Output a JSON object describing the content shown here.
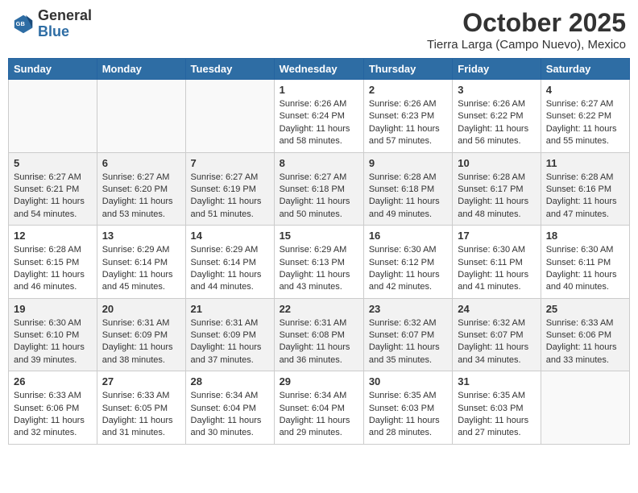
{
  "header": {
    "logo_general": "General",
    "logo_blue": "Blue",
    "month": "October 2025",
    "location": "Tierra Larga (Campo Nuevo), Mexico"
  },
  "weekdays": [
    "Sunday",
    "Monday",
    "Tuesday",
    "Wednesday",
    "Thursday",
    "Friday",
    "Saturday"
  ],
  "weeks": [
    [
      {
        "day": "",
        "sunrise": "",
        "sunset": "",
        "daylight": ""
      },
      {
        "day": "",
        "sunrise": "",
        "sunset": "",
        "daylight": ""
      },
      {
        "day": "",
        "sunrise": "",
        "sunset": "",
        "daylight": ""
      },
      {
        "day": "1",
        "sunrise": "Sunrise: 6:26 AM",
        "sunset": "Sunset: 6:24 PM",
        "daylight": "Daylight: 11 hours and 58 minutes."
      },
      {
        "day": "2",
        "sunrise": "Sunrise: 6:26 AM",
        "sunset": "Sunset: 6:23 PM",
        "daylight": "Daylight: 11 hours and 57 minutes."
      },
      {
        "day": "3",
        "sunrise": "Sunrise: 6:26 AM",
        "sunset": "Sunset: 6:22 PM",
        "daylight": "Daylight: 11 hours and 56 minutes."
      },
      {
        "day": "4",
        "sunrise": "Sunrise: 6:27 AM",
        "sunset": "Sunset: 6:22 PM",
        "daylight": "Daylight: 11 hours and 55 minutes."
      }
    ],
    [
      {
        "day": "5",
        "sunrise": "Sunrise: 6:27 AM",
        "sunset": "Sunset: 6:21 PM",
        "daylight": "Daylight: 11 hours and 54 minutes."
      },
      {
        "day": "6",
        "sunrise": "Sunrise: 6:27 AM",
        "sunset": "Sunset: 6:20 PM",
        "daylight": "Daylight: 11 hours and 53 minutes."
      },
      {
        "day": "7",
        "sunrise": "Sunrise: 6:27 AM",
        "sunset": "Sunset: 6:19 PM",
        "daylight": "Daylight: 11 hours and 51 minutes."
      },
      {
        "day": "8",
        "sunrise": "Sunrise: 6:27 AM",
        "sunset": "Sunset: 6:18 PM",
        "daylight": "Daylight: 11 hours and 50 minutes."
      },
      {
        "day": "9",
        "sunrise": "Sunrise: 6:28 AM",
        "sunset": "Sunset: 6:18 PM",
        "daylight": "Daylight: 11 hours and 49 minutes."
      },
      {
        "day": "10",
        "sunrise": "Sunrise: 6:28 AM",
        "sunset": "Sunset: 6:17 PM",
        "daylight": "Daylight: 11 hours and 48 minutes."
      },
      {
        "day": "11",
        "sunrise": "Sunrise: 6:28 AM",
        "sunset": "Sunset: 6:16 PM",
        "daylight": "Daylight: 11 hours and 47 minutes."
      }
    ],
    [
      {
        "day": "12",
        "sunrise": "Sunrise: 6:28 AM",
        "sunset": "Sunset: 6:15 PM",
        "daylight": "Daylight: 11 hours and 46 minutes."
      },
      {
        "day": "13",
        "sunrise": "Sunrise: 6:29 AM",
        "sunset": "Sunset: 6:14 PM",
        "daylight": "Daylight: 11 hours and 45 minutes."
      },
      {
        "day": "14",
        "sunrise": "Sunrise: 6:29 AM",
        "sunset": "Sunset: 6:14 PM",
        "daylight": "Daylight: 11 hours and 44 minutes."
      },
      {
        "day": "15",
        "sunrise": "Sunrise: 6:29 AM",
        "sunset": "Sunset: 6:13 PM",
        "daylight": "Daylight: 11 hours and 43 minutes."
      },
      {
        "day": "16",
        "sunrise": "Sunrise: 6:30 AM",
        "sunset": "Sunset: 6:12 PM",
        "daylight": "Daylight: 11 hours and 42 minutes."
      },
      {
        "day": "17",
        "sunrise": "Sunrise: 6:30 AM",
        "sunset": "Sunset: 6:11 PM",
        "daylight": "Daylight: 11 hours and 41 minutes."
      },
      {
        "day": "18",
        "sunrise": "Sunrise: 6:30 AM",
        "sunset": "Sunset: 6:11 PM",
        "daylight": "Daylight: 11 hours and 40 minutes."
      }
    ],
    [
      {
        "day": "19",
        "sunrise": "Sunrise: 6:30 AM",
        "sunset": "Sunset: 6:10 PM",
        "daylight": "Daylight: 11 hours and 39 minutes."
      },
      {
        "day": "20",
        "sunrise": "Sunrise: 6:31 AM",
        "sunset": "Sunset: 6:09 PM",
        "daylight": "Daylight: 11 hours and 38 minutes."
      },
      {
        "day": "21",
        "sunrise": "Sunrise: 6:31 AM",
        "sunset": "Sunset: 6:09 PM",
        "daylight": "Daylight: 11 hours and 37 minutes."
      },
      {
        "day": "22",
        "sunrise": "Sunrise: 6:31 AM",
        "sunset": "Sunset: 6:08 PM",
        "daylight": "Daylight: 11 hours and 36 minutes."
      },
      {
        "day": "23",
        "sunrise": "Sunrise: 6:32 AM",
        "sunset": "Sunset: 6:07 PM",
        "daylight": "Daylight: 11 hours and 35 minutes."
      },
      {
        "day": "24",
        "sunrise": "Sunrise: 6:32 AM",
        "sunset": "Sunset: 6:07 PM",
        "daylight": "Daylight: 11 hours and 34 minutes."
      },
      {
        "day": "25",
        "sunrise": "Sunrise: 6:33 AM",
        "sunset": "Sunset: 6:06 PM",
        "daylight": "Daylight: 11 hours and 33 minutes."
      }
    ],
    [
      {
        "day": "26",
        "sunrise": "Sunrise: 6:33 AM",
        "sunset": "Sunset: 6:06 PM",
        "daylight": "Daylight: 11 hours and 32 minutes."
      },
      {
        "day": "27",
        "sunrise": "Sunrise: 6:33 AM",
        "sunset": "Sunset: 6:05 PM",
        "daylight": "Daylight: 11 hours and 31 minutes."
      },
      {
        "day": "28",
        "sunrise": "Sunrise: 6:34 AM",
        "sunset": "Sunset: 6:04 PM",
        "daylight": "Daylight: 11 hours and 30 minutes."
      },
      {
        "day": "29",
        "sunrise": "Sunrise: 6:34 AM",
        "sunset": "Sunset: 6:04 PM",
        "daylight": "Daylight: 11 hours and 29 minutes."
      },
      {
        "day": "30",
        "sunrise": "Sunrise: 6:35 AM",
        "sunset": "Sunset: 6:03 PM",
        "daylight": "Daylight: 11 hours and 28 minutes."
      },
      {
        "day": "31",
        "sunrise": "Sunrise: 6:35 AM",
        "sunset": "Sunset: 6:03 PM",
        "daylight": "Daylight: 11 hours and 27 minutes."
      },
      {
        "day": "",
        "sunrise": "",
        "sunset": "",
        "daylight": ""
      }
    ]
  ]
}
